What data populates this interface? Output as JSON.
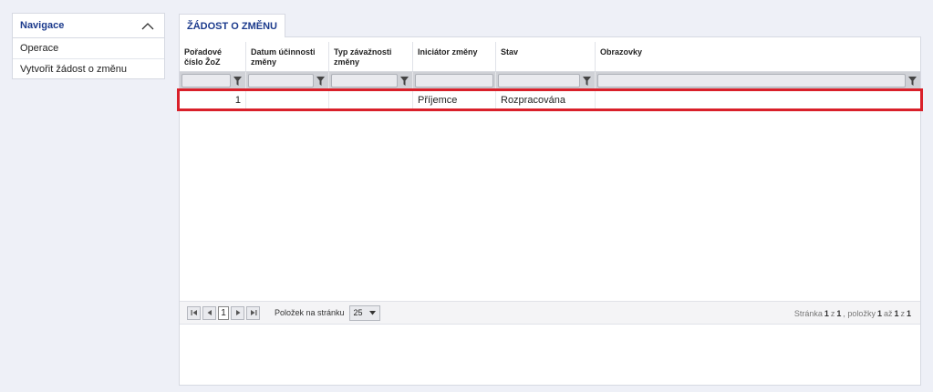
{
  "nav": {
    "title": "Navigace",
    "items": [
      {
        "label": "Operace"
      },
      {
        "label": "Vytvořit žádost o změnu"
      }
    ]
  },
  "tab": {
    "label": "ŽÁDOST O ZMĚNU"
  },
  "table": {
    "columns": [
      {
        "label": "Pořadové číslo ŽoZ"
      },
      {
        "label": "Datum účinnosti změny"
      },
      {
        "label": "Typ závažnosti změny"
      },
      {
        "label": "Iniciátor změny"
      },
      {
        "label": "Stav"
      },
      {
        "label": "Obrazovky"
      }
    ],
    "rows": [
      {
        "cells": [
          "1",
          "",
          "",
          "Příjemce",
          "Rozpracována",
          ""
        ]
      }
    ],
    "highlight_color": "#d9202a"
  },
  "pager": {
    "current_page": "1",
    "page_size_label": "Položek na stránku",
    "page_size": "25",
    "info": {
      "page_word": "Stránka",
      "page": "1",
      "of_word": "z",
      "pages": "1",
      "items_word": "položky",
      "from": "1",
      "to_word": "až",
      "to": "1",
      "of_word2": "z",
      "total": "1"
    }
  },
  "icons": {
    "nav_toggle": "chevron-up-icon",
    "filter": "funnel-icon",
    "first": "first-page-icon",
    "prev": "prev-page-icon",
    "next": "next-page-icon",
    "last": "last-page-icon",
    "dropdown": "caret-down-icon"
  },
  "colors": {
    "accent": "#1b3a8c",
    "background": "#eef0f7"
  }
}
